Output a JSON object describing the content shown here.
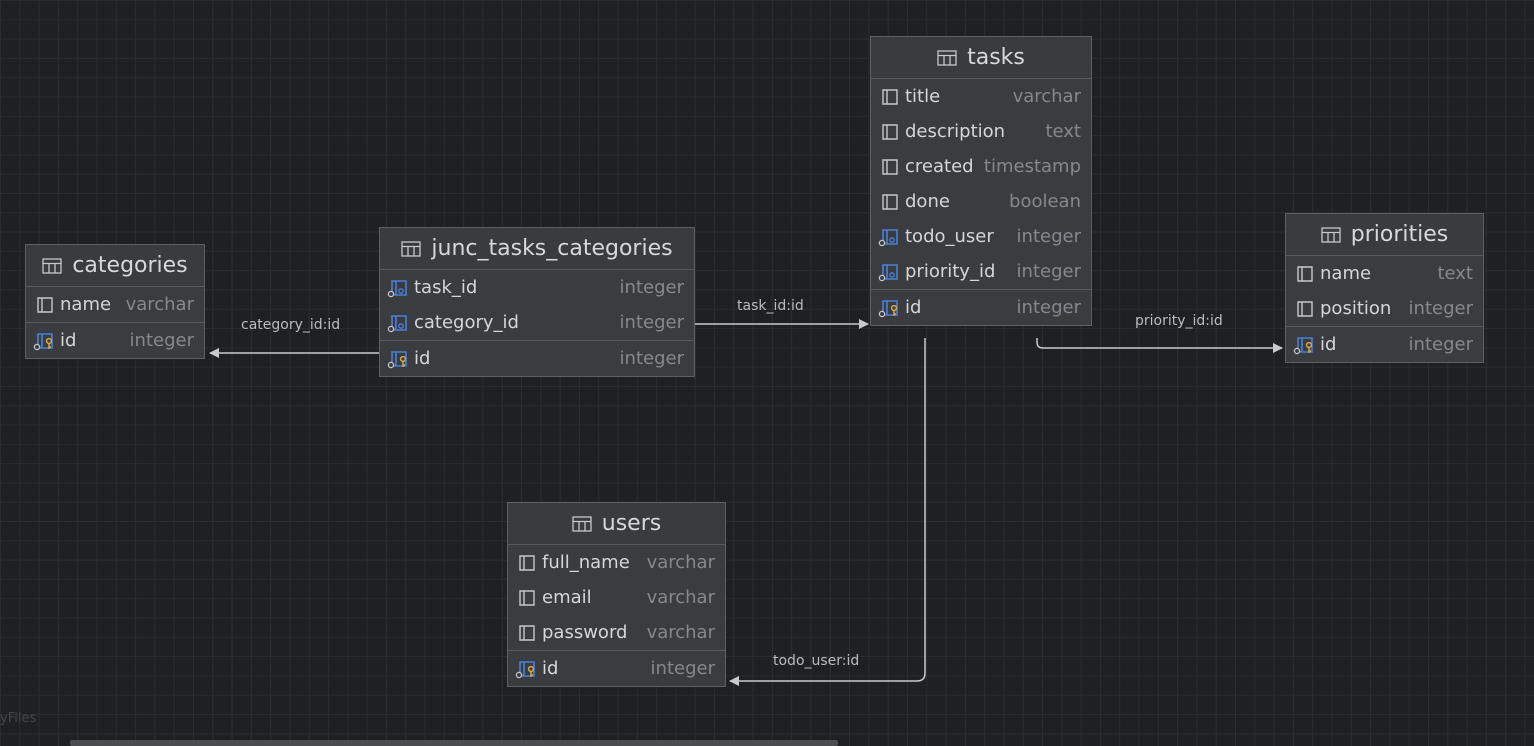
{
  "tables": {
    "tasks": {
      "name": "tasks",
      "columns": [
        {
          "name": "title",
          "type": "varchar",
          "icon": "column-icon"
        },
        {
          "name": "description",
          "type": "text",
          "icon": "column-icon"
        },
        {
          "name": "created",
          "type": "timestamp",
          "icon": "column-icon"
        },
        {
          "name": "done",
          "type": "boolean",
          "icon": "column-icon"
        },
        {
          "name": "todo_user",
          "type": "integer",
          "icon": "foreign-key-icon"
        },
        {
          "name": "priority_id",
          "type": "integer",
          "icon": "foreign-key-icon"
        }
      ],
      "pk": {
        "name": "id",
        "type": "integer",
        "icon": "primary-key-icon"
      }
    },
    "categories": {
      "name": "categories",
      "columns": [
        {
          "name": "name",
          "type": "varchar",
          "icon": "column-icon"
        }
      ],
      "pk": {
        "name": "id",
        "type": "integer",
        "icon": "primary-key-icon"
      }
    },
    "junc": {
      "name": "junc_tasks_categories",
      "columns": [
        {
          "name": "task_id",
          "type": "integer",
          "icon": "foreign-key-icon"
        },
        {
          "name": "category_id",
          "type": "integer",
          "icon": "foreign-key-icon"
        }
      ],
      "pk": {
        "name": "id",
        "type": "integer",
        "icon": "primary-key-icon"
      }
    },
    "priorities": {
      "name": "priorities",
      "columns": [
        {
          "name": "name",
          "type": "text",
          "icon": "column-icon"
        },
        {
          "name": "position",
          "type": "integer",
          "icon": "column-icon"
        }
      ],
      "pk": {
        "name": "id",
        "type": "integer",
        "icon": "primary-key-icon"
      }
    },
    "users": {
      "name": "users",
      "columns": [
        {
          "name": "full_name",
          "type": "varchar",
          "icon": "column-icon"
        },
        {
          "name": "email",
          "type": "varchar",
          "icon": "column-icon"
        },
        {
          "name": "password",
          "type": "varchar",
          "icon": "column-icon"
        }
      ],
      "pk": {
        "name": "id",
        "type": "integer",
        "icon": "primary-key-icon"
      }
    }
  },
  "relations": {
    "category": "category_id:id",
    "task": "task_id:id",
    "priority": "priority_id:id",
    "todo_user": "todo_user:id"
  },
  "watermark": "yFiles",
  "colors": {
    "background": "#1f2023",
    "table_body": "#3a3c40",
    "edge": "#c8cacf",
    "key_icon": "#d6a84a",
    "fk_icon": "#4b7fd8"
  }
}
